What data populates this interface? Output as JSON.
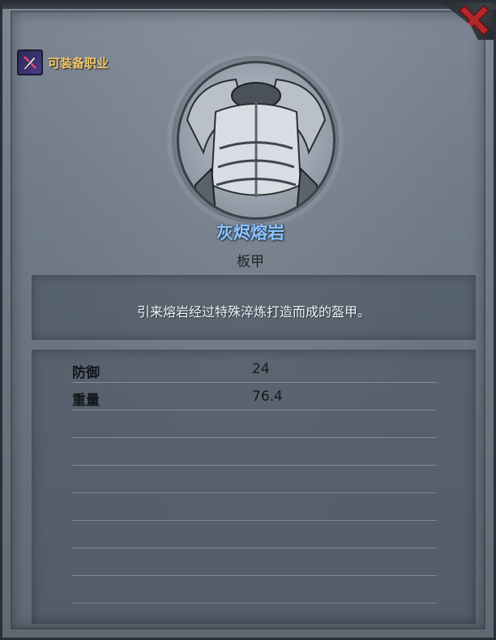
{
  "class_badge": {
    "label": "可装备职业",
    "icon": "class-sword-icon"
  },
  "item": {
    "name": "灰烬熔岩",
    "type": "板甲",
    "description": "引来熔岩经过特殊淬炼打造而成的盔甲。",
    "icon": "plate-armor-icon"
  },
  "stats": [
    {
      "label": "防御",
      "value": "24"
    },
    {
      "label": "重量",
      "value": "76.4"
    },
    {
      "label": "",
      "value": ""
    },
    {
      "label": "",
      "value": ""
    },
    {
      "label": "",
      "value": ""
    },
    {
      "label": "",
      "value": ""
    },
    {
      "label": "",
      "value": ""
    },
    {
      "label": "",
      "value": ""
    },
    {
      "label": "",
      "value": ""
    }
  ],
  "colors": {
    "item_name": "#8cc4ff",
    "class_label": "#f1c76a",
    "close_x": "#c0282c"
  },
  "close_icon": "close-x-icon"
}
